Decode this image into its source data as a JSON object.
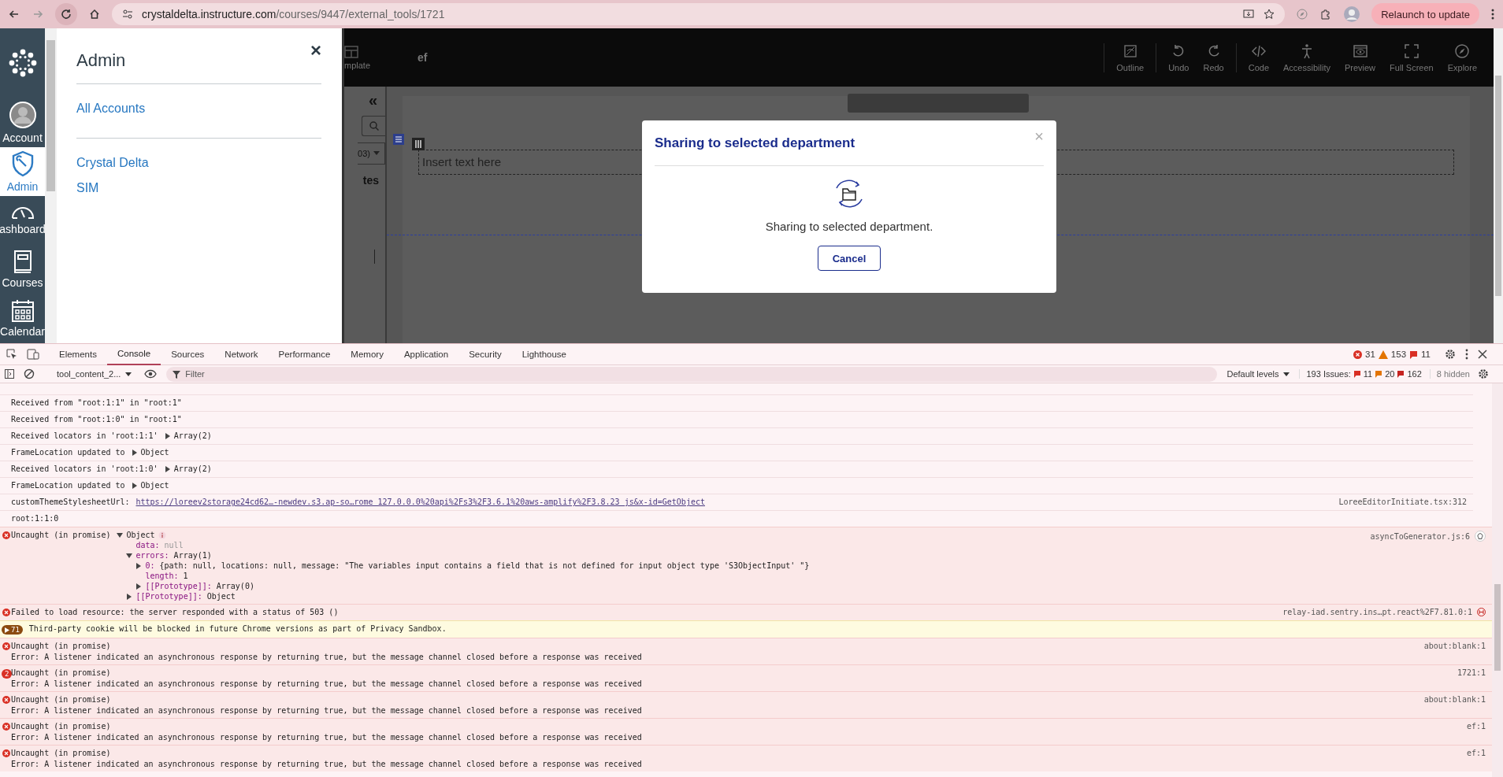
{
  "browser": {
    "url_host": "crystaldelta.instructure.com",
    "url_path": "/courses/9447/external_tools/1721",
    "relaunch": "Relaunch to update"
  },
  "global_nav": [
    {
      "kind": "logo"
    },
    {
      "kind": "account",
      "label": "Account",
      "selected": false
    },
    {
      "kind": "admin",
      "label": "Admin",
      "selected": true
    },
    {
      "kind": "dashboard",
      "label": "ashboard",
      "selected": false
    },
    {
      "kind": "courses",
      "label": "Courses",
      "selected": false
    },
    {
      "kind": "calendar",
      "label": "Calendar",
      "selected": false
    }
  ],
  "admin_tray": {
    "title": "Admin",
    "close": "×",
    "sections": [
      [
        "All Accounts"
      ],
      [
        "Crystal Delta",
        "SIM"
      ]
    ]
  },
  "editor": {
    "toolbar_left": "mplate",
    "doc_title": "ef",
    "tools": [
      {
        "kind": "outline",
        "label": "Outline"
      },
      {
        "kind": "undo",
        "label": "Undo"
      },
      {
        "kind": "redo",
        "label": "Redo"
      },
      {
        "kind": "code",
        "label": "Code"
      },
      {
        "kind": "accessibility",
        "label": "Accessibility"
      },
      {
        "kind": "preview",
        "label": "Preview"
      },
      {
        "kind": "fullscreen",
        "label": "Full Screen"
      },
      {
        "kind": "explore",
        "label": "Explore"
      }
    ],
    "collapse": "«",
    "sidebar_select": "03)",
    "sidebar_heading": "tes",
    "text_block": "Insert text here"
  },
  "modal": {
    "title": "Sharing to selected department",
    "close": "×",
    "message": "Sharing to selected department.",
    "button": "Cancel"
  },
  "devtools": {
    "tabs": [
      {
        "label": "Elements",
        "selected": false
      },
      {
        "label": "Console",
        "selected": true
      },
      {
        "label": "Sources",
        "selected": false
      },
      {
        "label": "Network",
        "selected": false
      },
      {
        "label": "Performance",
        "selected": false
      },
      {
        "label": "Memory",
        "selected": false
      },
      {
        "label": "Application",
        "selected": false
      },
      {
        "label": "Security",
        "selected": false
      },
      {
        "label": "Lighthouse",
        "selected": false
      }
    ],
    "error_count": "31",
    "warning_count": "153",
    "info_count": "11",
    "context": "tool_content_2...",
    "filter_placeholder": "Filter",
    "levels": "Default levels",
    "issues_label": "193 Issues:",
    "issue_counts": [
      {
        "kind": "error",
        "text": "11"
      },
      {
        "kind": "warning",
        "text": "20"
      },
      {
        "kind": "info",
        "text": "162"
      }
    ],
    "hidden": "8 hidden",
    "messages": [
      {
        "kind": "log",
        "text": "Received from \"root:1:1\" in \"root:1\""
      },
      {
        "kind": "log",
        "text": "Received from \"root:1:0\" in \"root:1\""
      },
      {
        "kind": "log",
        "text": "Received locators in 'root:1:1'",
        "arg": "Array(2)"
      },
      {
        "kind": "log",
        "text": "FrameLocation updated to",
        "arg": "Object"
      },
      {
        "kind": "log",
        "text": "Received locators in 'root:1:0'",
        "arg": "Array(2)"
      },
      {
        "kind": "log",
        "text": "FrameLocation updated to",
        "arg": "Object"
      },
      {
        "kind": "log",
        "text": "customThemeStylesheetUrl:",
        "link": "https://loreev2storage24cd62…-newdev.s3.ap-so…rome 127.0.0.0%20api%2Fs3%2F3.6.1%20aws-amplify%2F3.8.23 js&x-id=GetObject",
        "source": "LoreeEditorInitiate.tsx:312"
      },
      {
        "kind": "log",
        "text": "root:1:1:0"
      },
      {
        "kind": "error",
        "text": "Uncaught (in promise)",
        "source": "asyncToGenerator.js:6",
        "tree": {
          "key": "Object",
          "expanded": true,
          "children": [
            {
              "key": "data:",
              "value": "null"
            },
            {
              "key": "errors:",
              "value": "Array(1)",
              "expanded": true,
              "children": [
                {
                  "key": "0:",
                  "value": "{path: null, locations: null, message: \"The variables input contains a field that is not defined for input object type 'S3ObjectInput' \"}",
                  "expanded": false
                },
                {
                  "key": "length:",
                  "value": "1"
                },
                {
                  "key": "[[Prototype]]:",
                  "value": "Array(0)",
                  "expanded": false
                }
              ]
            },
            {
              "key": "[[Prototype]]:",
              "value": "Object",
              "expanded": false
            }
          ]
        }
      },
      {
        "kind": "error",
        "text": "Failed to load resource: the server responded with a status of 503 ()",
        "source": "relay-iad.sentry.ins…pt.react%2F7.81.0:1"
      },
      {
        "kind": "warning",
        "count": "71",
        "text": "Third-party cookie will be blocked in future Chrome versions as part of Privacy Sandbox."
      },
      {
        "kind": "error",
        "text": "Uncaught (in promise)",
        "detail": "Error: A listener indicated an asynchronous response by returning true, but the message channel closed before a response was received",
        "source": "about:blank:1"
      },
      {
        "kind": "error",
        "count": "2",
        "text": "Uncaught (in promise)",
        "detail": "Error: A listener indicated an asynchronous response by returning true, but the message channel closed before a response was received",
        "source": "1721:1"
      },
      {
        "kind": "error",
        "text": "Uncaught (in promise)",
        "detail": "Error: A listener indicated an asynchronous response by returning true, but the message channel closed before a response was received",
        "source": "about:blank:1"
      },
      {
        "kind": "error",
        "text": "Uncaught (in promise)",
        "detail": "Error: A listener indicated an asynchronous response by returning true, but the message channel closed before a response was received",
        "source": "ef:1"
      },
      {
        "kind": "error",
        "text": "Uncaught (in promise)",
        "detail": "Error: A listener indicated an asynchronous response by returning true, but the message channel closed before a response was received",
        "source": "ef:1"
      }
    ]
  }
}
